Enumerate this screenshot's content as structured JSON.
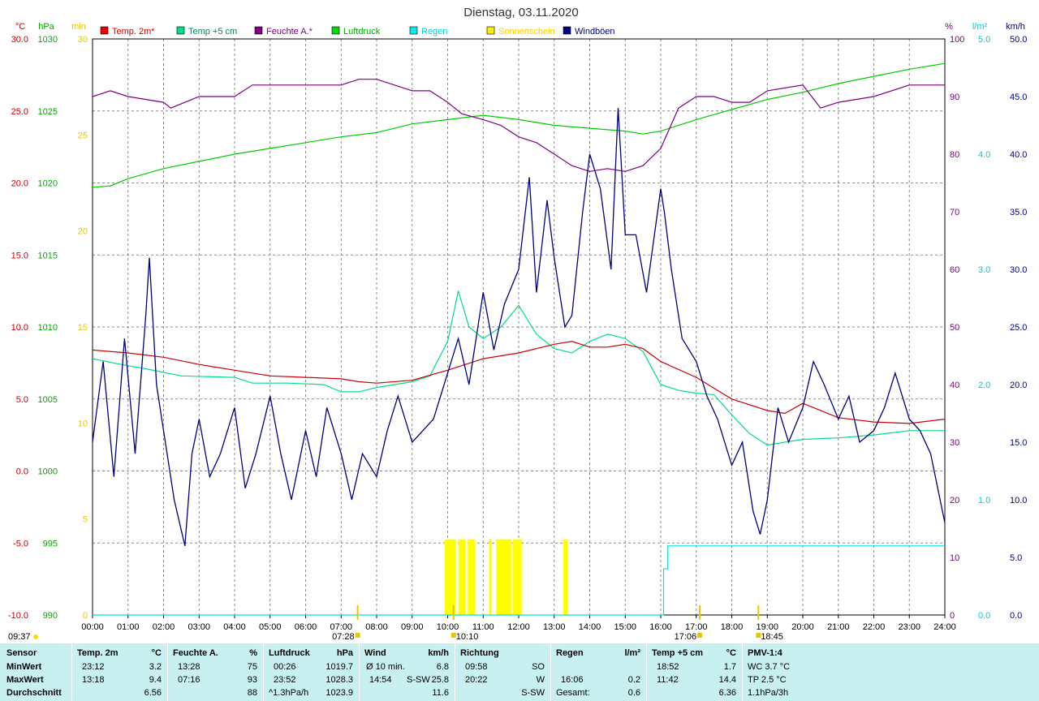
{
  "chart_data": {
    "type": "line",
    "title": "Dienstag, 03.11.2020",
    "x_ticks": [
      "00:00",
      "01:00",
      "02:00",
      "03:00",
      "04:00",
      "05:00",
      "06:00",
      "07:00",
      "08:00",
      "09:00",
      "10:00",
      "11:00",
      "12:00",
      "13:00",
      "14:00",
      "15:00",
      "16:00",
      "17:00",
      "18:00",
      "19:00",
      "20:00",
      "21:00",
      "22:00",
      "23:00",
      "24:00"
    ],
    "xlim": [
      0,
      24
    ],
    "axes": {
      "temp": {
        "unit": "°C",
        "range": [
          -10,
          30
        ],
        "ticks": [
          "30.0",
          "25.0",
          "20.0",
          "15.0",
          "10.0",
          "5.0",
          "0.0",
          "-5.0",
          "-10.0"
        ]
      },
      "pressure": {
        "unit": "hPa",
        "range": [
          990,
          1030
        ],
        "ticks": [
          "1030",
          "1025",
          "1020",
          "1015",
          "1010",
          "1005",
          "1000",
          "995",
          "990"
        ]
      },
      "sunshine": {
        "unit": "min",
        "range": [
          0,
          30
        ],
        "ticks": [
          "30",
          "25",
          "20",
          "15",
          "10",
          "5",
          "0"
        ]
      },
      "humidity": {
        "unit": "%",
        "range": [
          0,
          100
        ],
        "ticks": [
          "100",
          "90",
          "80",
          "70",
          "60",
          "50",
          "40",
          "30",
          "20",
          "10",
          "0"
        ]
      },
      "rain": {
        "unit": "l/m²",
        "range": [
          0,
          5
        ],
        "ticks": [
          "5.0",
          "4.0",
          "3.0",
          "2.0",
          "1.0",
          "0.0"
        ]
      },
      "wind": {
        "unit": "km/h",
        "range": [
          0,
          50
        ],
        "ticks": [
          "50.0",
          "45.0",
          "40.0",
          "35.0",
          "30.0",
          "25.0",
          "20.0",
          "15.0",
          "10.0",
          "5.0",
          "0.0"
        ]
      }
    },
    "legend": [
      "Temp. 2m*",
      "Temp +5 cm",
      "Feuchte A.*",
      "Luftdruck",
      "Regen",
      "Sonnenschein",
      "Windböen"
    ],
    "series": [
      {
        "name": "Temp. 2m*",
        "axis": "temp",
        "color": "#cc0000",
        "x": [
          0,
          1,
          2,
          3,
          4,
          5,
          6,
          7,
          7.5,
          8,
          9,
          10,
          11,
          12,
          13,
          13.5,
          14,
          14.5,
          15,
          15.5,
          16,
          17,
          18,
          19,
          19.5,
          20,
          21,
          22,
          23,
          24
        ],
        "y": [
          8.4,
          8.2,
          7.9,
          7.4,
          7.0,
          6.6,
          6.5,
          6.4,
          6.2,
          6.1,
          6.3,
          7.0,
          7.8,
          8.2,
          8.8,
          9.0,
          8.6,
          8.6,
          8.8,
          8.5,
          7.6,
          6.5,
          5.0,
          4.2,
          4.0,
          4.7,
          3.7,
          3.4,
          3.3,
          3.6
        ]
      },
      {
        "name": "Temp +5 cm",
        "axis": "temp",
        "color": "#00dd88",
        "x": [
          0,
          0.8,
          1.5,
          2.5,
          4,
          4.5,
          5.5,
          6.5,
          7,
          7.5,
          8,
          9,
          9.5,
          10,
          10.3,
          10.6,
          11,
          11.5,
          12,
          12.5,
          13,
          13.5,
          14,
          14.5,
          15,
          15.5,
          16,
          16.5,
          17,
          17.5,
          18,
          18.5,
          19,
          19.5,
          20,
          21,
          22,
          23,
          24
        ],
        "y": [
          7.8,
          7.4,
          7.1,
          6.6,
          6.5,
          6.1,
          6.1,
          6.0,
          5.5,
          5.5,
          5.8,
          6.2,
          6.6,
          9.0,
          12.5,
          10.0,
          9.2,
          10.0,
          11.5,
          9.5,
          8.5,
          8.2,
          9.0,
          9.5,
          9.2,
          8.3,
          6.0,
          5.6,
          5.4,
          5.3,
          3.9,
          2.6,
          1.8,
          2.0,
          2.2,
          2.3,
          2.5,
          2.8,
          2.8
        ]
      },
      {
        "name": "Feuchte A.*",
        "axis": "humidity",
        "color": "#7b0080",
        "x": [
          0,
          0.5,
          1,
          2,
          2.2,
          3,
          4,
          4.5,
          6,
          7,
          7.5,
          8,
          9,
          9.5,
          10,
          10.4,
          11,
          11.5,
          12,
          12.5,
          13,
          13.5,
          14,
          14.5,
          15,
          15.5,
          16,
          16.5,
          17,
          17.5,
          18,
          18.5,
          19,
          20,
          20.5,
          21,
          22,
          23,
          24
        ],
        "y": [
          90,
          91,
          90,
          89,
          88,
          90,
          90,
          92,
          92,
          92,
          93,
          93,
          91,
          91,
          89,
          87,
          86,
          85,
          83,
          82,
          80,
          78,
          77,
          77.5,
          77,
          78,
          81,
          88,
          90,
          90,
          89,
          89,
          91,
          92,
          88,
          89,
          90,
          92,
          92
        ]
      },
      {
        "name": "Luftdruck",
        "axis": "pressure",
        "color": "#00cc00",
        "x": [
          0,
          0.5,
          1,
          2,
          3,
          4,
          5,
          6,
          7,
          8,
          9,
          10,
          11,
          12,
          12.5,
          13,
          14,
          15,
          15.5,
          16,
          17,
          18,
          19,
          20,
          21,
          22,
          23,
          24
        ],
        "y": [
          1019.7,
          1019.8,
          1020.3,
          1021.0,
          1021.5,
          1022.0,
          1022.4,
          1022.8,
          1023.2,
          1023.5,
          1024.1,
          1024.4,
          1024.7,
          1024.4,
          1024.2,
          1024.0,
          1023.8,
          1023.6,
          1023.4,
          1023.6,
          1024.4,
          1025.1,
          1025.8,
          1026.3,
          1026.9,
          1027.4,
          1027.9,
          1028.3
        ]
      },
      {
        "name": "Regen",
        "axis": "rain",
        "color": "#00e0e0",
        "x": [
          0,
          16.0,
          16.08,
          16.1,
          16.2,
          16.25,
          24
        ],
        "y": [
          0,
          0,
          0.4,
          0.4,
          0.6,
          0.6,
          0.6
        ]
      },
      {
        "name": "Windböen",
        "axis": "wind",
        "color": "#000080",
        "x": [
          0,
          0.3,
          0.6,
          0.9,
          1.2,
          1.5,
          1.6,
          1.8,
          2.0,
          2.3,
          2.6,
          2.8,
          3.0,
          3.3,
          3.6,
          4.0,
          4.3,
          4.6,
          5.0,
          5.3,
          5.6,
          6.0,
          6.3,
          6.6,
          7.0,
          7.3,
          7.6,
          8.0,
          8.3,
          8.6,
          9.0,
          9.3,
          9.6,
          10.0,
          10.3,
          10.6,
          11.0,
          11.3,
          11.6,
          12.0,
          12.3,
          12.5,
          12.8,
          13.0,
          13.3,
          13.5,
          13.8,
          14.0,
          14.3,
          14.6,
          14.8,
          15.0,
          15.3,
          15.6,
          16.0,
          16.1,
          16.3,
          16.6,
          17.0,
          17.3,
          17.6,
          18.0,
          18.3,
          18.6,
          18.8,
          19.0,
          19.3,
          19.6,
          20.0,
          20.3,
          20.6,
          21.0,
          21.3,
          21.6,
          22.0,
          22.3,
          22.6,
          23.0,
          23.3,
          23.6,
          24.0
        ],
        "y": [
          15,
          22,
          12,
          24,
          14,
          26,
          31,
          20,
          16,
          10,
          6,
          14,
          17,
          12,
          14,
          18,
          11,
          14,
          19,
          14,
          10,
          16,
          12,
          18,
          14,
          10,
          14,
          12,
          16,
          19,
          15,
          16,
          17,
          21,
          24,
          20,
          28,
          23,
          27,
          30,
          38,
          28,
          36,
          31,
          25,
          26,
          35,
          40,
          37,
          30,
          44,
          33,
          33,
          28,
          37,
          35,
          30,
          24,
          22,
          19,
          17,
          13,
          15,
          9,
          7,
          10,
          18,
          15,
          18,
          22,
          20,
          17,
          19,
          15,
          16,
          18,
          21,
          17,
          16,
          14,
          8
        ]
      }
    ],
    "sunshine_bars": [
      {
        "from": "09:55",
        "to": "10:14",
        "minutes": 2
      },
      {
        "from": "10:18",
        "to": "10:30",
        "minutes": 2
      },
      {
        "from": "10:34",
        "to": "10:46",
        "minutes": 2
      },
      {
        "from": "11:10",
        "to": "11:14",
        "minutes": 2
      },
      {
        "from": "11:22",
        "to": "11:48",
        "minutes": 2
      },
      {
        "from": "11:50",
        "to": "12:05",
        "minutes": 2
      },
      {
        "from": "13:15",
        "to": "13:23",
        "minutes": 2
      }
    ],
    "markers": [
      {
        "label": "09:37",
        "kind": "sunrise-left"
      },
      {
        "label": "07:28",
        "kind": "sunrise"
      },
      {
        "label": "10:10",
        "kind": "min-marker"
      },
      {
        "label": "17:06",
        "kind": "sunset"
      },
      {
        "label": "18:45",
        "kind": "marker"
      }
    ]
  },
  "stats": {
    "row_labels": {
      "sensor": "Sensor",
      "min": "MinWert",
      "max": "MaxWert",
      "avg": "Durchschnitt"
    },
    "temp2m": {
      "title": "Temp. 2m",
      "unit": "°C",
      "min_time": "23:12",
      "min_val": "3.2",
      "max_time": "13:18",
      "max_val": "9.4",
      "avg": "6.56"
    },
    "humidity": {
      "title": "Feuchte A.",
      "unit": "%",
      "min_time": "13:28",
      "min_val": "75",
      "max_time": "07:16",
      "max_val": "93",
      "avg": "88"
    },
    "pressure": {
      "title": "Luftdruck",
      "unit": "hPa",
      "min_time": "00:26",
      "min_val": "1019.7",
      "max_time": "23:52",
      "max_val": "1028.3",
      "trend": "^1.3hPa/h",
      "avg": "1023.9"
    },
    "wind": {
      "title": "Wind",
      "unit": "km/h",
      "r1_label": "Ø 10 min.",
      "r1_val": "6.8",
      "r2_time": "14:54",
      "r2_dir": "S-SW",
      "r2_val": "25.8",
      "avg": "11.6"
    },
    "direction": {
      "title": "Richtung",
      "r1_time": "09:58",
      "r1_val": "SO",
      "r2_time": "20:22",
      "r2_val": "W",
      "avg": "S-SW"
    },
    "rain": {
      "title": "Regen",
      "unit": "l/m²",
      "r2_time": "16:06",
      "r2_val": "0.2",
      "total_label": "Gesamt:",
      "total_val": "0.6"
    },
    "temp5cm": {
      "title": "Temp +5 cm",
      "unit": "°C",
      "min_time": "18:52",
      "min_val": "1.7",
      "max_time": "11:42",
      "max_val": "14.4",
      "avg": "6.36"
    },
    "pmv": {
      "title": "PMV-1:4",
      "r1": "WC 3.7 °C",
      "r2": "TP 2.5 °C",
      "r3": "1.1hPa/3h"
    }
  }
}
